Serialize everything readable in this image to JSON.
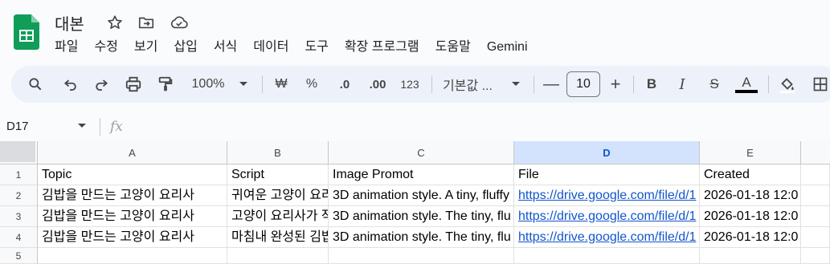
{
  "doc": {
    "title": "대본",
    "app_icon": "google-sheets-logo",
    "title_icons": [
      "star-icon",
      "move-to-folder-icon",
      "cloud-saved-icon"
    ]
  },
  "menu": [
    "파일",
    "수정",
    "보기",
    "삽입",
    "서식",
    "데이터",
    "도구",
    "확장 프로그램",
    "도움말",
    "Gemini"
  ],
  "toolbar": {
    "zoom": "100%",
    "currency": "₩",
    "percent": "%",
    "decrease_decimal": ".0",
    "increase_decimal": ".00",
    "number_format": "123",
    "font": "기본값 ...",
    "font_size": "10",
    "minus": "—",
    "plus": "+",
    "bold": "B",
    "italic": "I",
    "strike": "S",
    "text_color": "A",
    "text_color_value": "#000000"
  },
  "formula_bar": {
    "name_box": "D17",
    "fx": "fx",
    "formula": ""
  },
  "sheet": {
    "selected_column": "D",
    "columns": [
      "A",
      "B",
      "C",
      "D",
      "E"
    ],
    "row_numbers": [
      "1",
      "2",
      "3",
      "4",
      "5"
    ],
    "rows": [
      [
        "Topic",
        "Script",
        "Image Promot",
        "File",
        "Created"
      ],
      [
        "김밥을 만드는 고양이 요리사",
        "귀여운 고양이 요리",
        "3D animation style. A tiny, fluffy",
        "https://drive.google.com/file/d/1",
        "2026-01-18 12:0"
      ],
      [
        "김밥을 만드는 고양이 요리사",
        "고양이 요리사가 작",
        "3D animation style. The tiny, flu",
        "https://drive.google.com/file/d/1",
        "2026-01-18 12:0"
      ],
      [
        "김밥을 만드는 고양이 요리사",
        "마침내 완성된 김밥",
        "3D animation style. The tiny, flu",
        "https://drive.google.com/file/d/1",
        "2026-01-18 12:0"
      ],
      [
        "",
        "",
        "",
        "",
        ""
      ]
    ]
  },
  "colors": {
    "sheets_green": "#0f9d58",
    "link": "#1155cc",
    "selected_header": "#d3e3fd",
    "toolbar_bg": "#edf2fa"
  }
}
